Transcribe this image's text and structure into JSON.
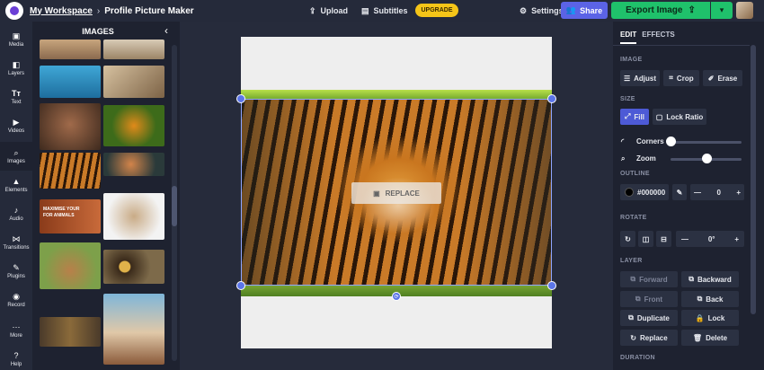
{
  "topbar": {
    "workspace": "My Workspace",
    "separator": "›",
    "title": "Profile Picture Maker",
    "upload": "Upload",
    "subtitles": "Subtitles",
    "upgrade": "UPGRADE",
    "settings": "Settings",
    "share": "Share",
    "export": "Export Image",
    "icons": [
      "upload-icon",
      "subtitles-icon",
      "gear-icon",
      "share-icon",
      "export-icon",
      "chevron-down-icon"
    ]
  },
  "rail": {
    "items": [
      {
        "label": "Media",
        "icon": "media-icon"
      },
      {
        "label": "Layers",
        "icon": "layers-icon"
      },
      {
        "label": "Text",
        "icon": "text-icon"
      },
      {
        "label": "Videos",
        "icon": "videos-icon"
      },
      {
        "label": "Images",
        "icon": "search-icon",
        "active": true
      },
      {
        "label": "Elements",
        "icon": "elements-icon"
      },
      {
        "label": "Audio",
        "icon": "audio-icon"
      },
      {
        "label": "Transitions",
        "icon": "transitions-icon"
      },
      {
        "label": "Plugins",
        "icon": "plugins-icon"
      },
      {
        "label": "Record",
        "icon": "record-icon"
      },
      {
        "label": "More",
        "icon": "more-icon"
      },
      {
        "label": "Help",
        "icon": "help-icon"
      }
    ]
  },
  "panel": {
    "title": "IMAGES",
    "thumb_caption": "MAXIMISE YOUR\nFOR ANIMALS"
  },
  "canvas": {
    "replace": "REPLACE"
  },
  "right": {
    "tab_edit": "EDIT",
    "tab_effects": "EFFECTS",
    "image_head": "IMAGE",
    "adjust": "Adjust",
    "crop": "Crop",
    "erase": "Erase",
    "size_head": "SIZE",
    "fill": "Fill",
    "lock_ratio": "Lock Ratio",
    "corners": "Corners",
    "zoom": "Zoom",
    "corners_level": 0.0,
    "zoom_level": 0.5,
    "outline_head": "OUTLINE",
    "outline_color": "#000000",
    "outline_value": "0",
    "rotate_head": "ROTATE",
    "rotate_value": "0°",
    "layer_head": "LAYER",
    "forward": "Forward",
    "backward": "Backward",
    "front": "Front",
    "back": "Back",
    "duplicate": "Duplicate",
    "lock": "Lock",
    "replace": "Replace",
    "delete": "Delete",
    "duration_head": "DURATION"
  },
  "colors": {
    "accent": "#5b63e6",
    "export": "#1fc16b",
    "upgrade": "#f5c518",
    "handle": "#5b75e8"
  }
}
